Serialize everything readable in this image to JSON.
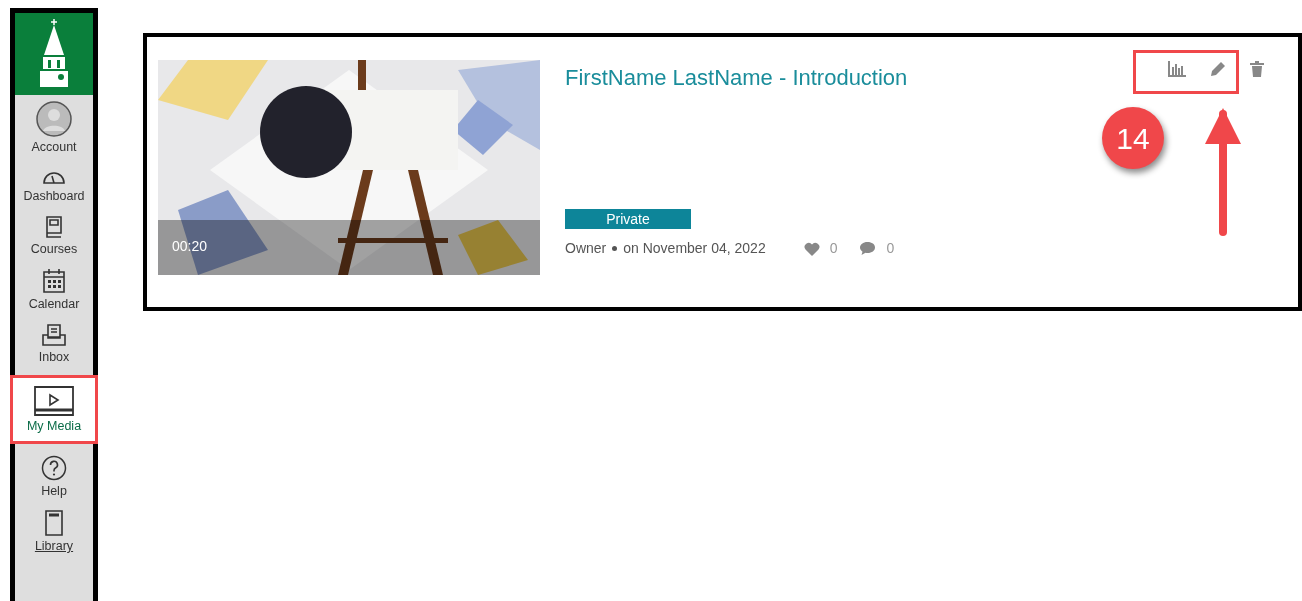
{
  "sidebar": {
    "items": [
      {
        "kind": "account",
        "label": "Account",
        "selected": false
      },
      {
        "kind": "dashboard",
        "label": "Dashboard",
        "selected": false
      },
      {
        "kind": "courses",
        "label": "Courses",
        "selected": false
      },
      {
        "kind": "calendar",
        "label": "Calendar",
        "selected": false
      },
      {
        "kind": "inbox",
        "label": "Inbox",
        "selected": false
      },
      {
        "kind": "media",
        "label": "My Media",
        "selected": true
      },
      {
        "kind": "help",
        "label": "Help",
        "selected": false
      },
      {
        "kind": "library",
        "label": "Library",
        "selected": false
      }
    ]
  },
  "media_entry": {
    "duration": "00:20",
    "title": "FirstName LastName - Introduction",
    "status": "Private",
    "owner": "Owner",
    "date": "on November 04, 2022",
    "likes": "0",
    "comments": "0"
  },
  "annotation": {
    "step": "14"
  }
}
